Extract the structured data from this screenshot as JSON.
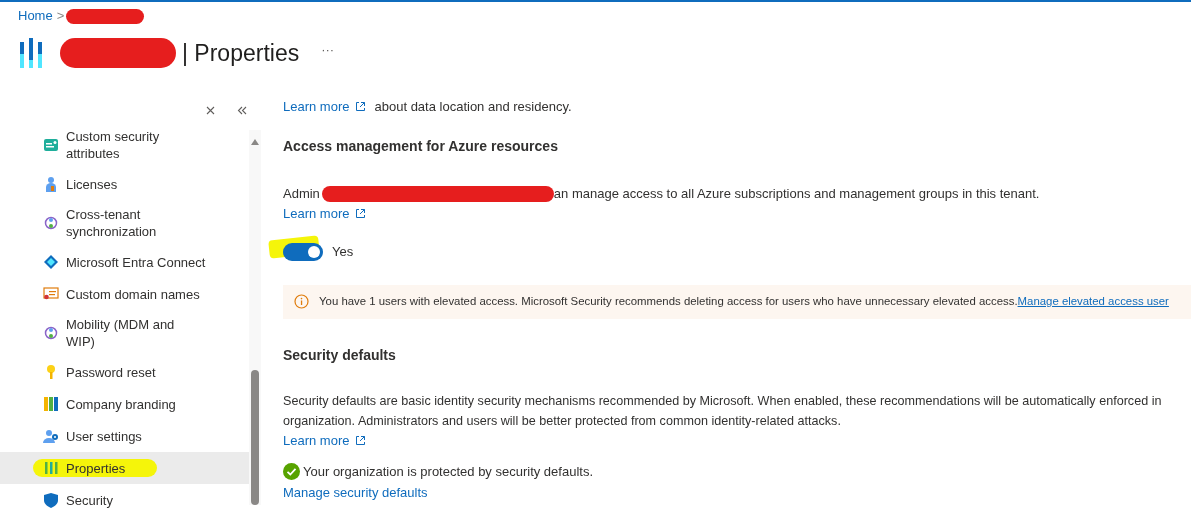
{
  "breadcrumb": {
    "items": [
      {
        "label": "Home"
      }
    ],
    "separator": ">"
  },
  "header": {
    "title": "| Properties",
    "more": "···"
  },
  "sidebar": {
    "items": [
      {
        "label": "Custom security attributes",
        "selected": false
      },
      {
        "label": "Licenses",
        "selected": false
      },
      {
        "label": "Cross-tenant synchronization",
        "selected": false
      },
      {
        "label": "Microsoft Entra Connect",
        "selected": false
      },
      {
        "label": "Custom domain names",
        "selected": false
      },
      {
        "label": "Mobility (MDM and WIP)",
        "selected": false
      },
      {
        "label": "Password reset",
        "selected": false
      },
      {
        "label": "Company branding",
        "selected": false
      },
      {
        "label": "User settings",
        "selected": false
      },
      {
        "label": "Properties",
        "selected": true
      },
      {
        "label": "Security",
        "selected": false
      }
    ]
  },
  "content": {
    "top_line": {
      "link": "Learn more",
      "text": "about data location and residency."
    },
    "access_management": {
      "heading": "Access management for Azure resources",
      "text_start": "Admin",
      "text_end": "an manage access to all Azure subscriptions and management groups in this tenant.",
      "link": "Learn more",
      "toggle": {
        "on": true,
        "label": "Yes"
      }
    },
    "banner": {
      "text": "You have 1 users with elevated access. Microsoft Security recommends deleting access for users who have unnecessary elevated access.",
      "link": "Manage elevated access user"
    },
    "security_defaults": {
      "heading": "Security defaults",
      "lines": [
        "Security defaults are basic identity security mechanisms recommended by Microsoft. When enabled, these recommendations will be automatically enforced in",
        "organization. Administrators and users will be better protected from common identity-related attacks."
      ],
      "link": "Learn more",
      "status": "Your organization is protected by security defaults.",
      "manage_link": "Manage security defaults"
    }
  }
}
